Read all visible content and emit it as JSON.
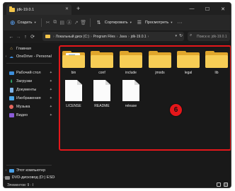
{
  "window": {
    "tab_title": "jdk-19.0.1",
    "tab_close": "✕",
    "new_tab": "+",
    "controls": {
      "minimize": "—",
      "maximize": "☐",
      "close": "✕"
    }
  },
  "commandbar": {
    "create_label": "Создать",
    "sort_label": "Сортировать",
    "view_label": "Просмотреть",
    "more": "···"
  },
  "address": {
    "crumbs": [
      "Локальный диск (C:)",
      "Program Files",
      "Java",
      "jdk-19.0.1"
    ],
    "search_placeholder": "Поиск в: jdk-19.0.1"
  },
  "sidebar": {
    "items": [
      {
        "label": "Главная"
      },
      {
        "label": "OneDrive - Personal"
      },
      {
        "label": "Рабочий стол"
      },
      {
        "label": "Загрузки"
      },
      {
        "label": "Документы"
      },
      {
        "label": "Изображения"
      },
      {
        "label": "Музыка"
      },
      {
        "label": "Видео"
      },
      {
        "label": "Этот компьютер"
      },
      {
        "label": "DVD-дисковод (D:) ESD-I"
      },
      {
        "label": "Сеть"
      }
    ]
  },
  "content": {
    "folders": [
      "bin",
      "conf",
      "include",
      "jmods",
      "legal",
      "lib"
    ],
    "files": [
      "LICENSE",
      "README",
      "release"
    ],
    "annotation_number": "6",
    "highlight_color": "#e5161a"
  },
  "status": {
    "text": "Элементов: 9 · I"
  }
}
